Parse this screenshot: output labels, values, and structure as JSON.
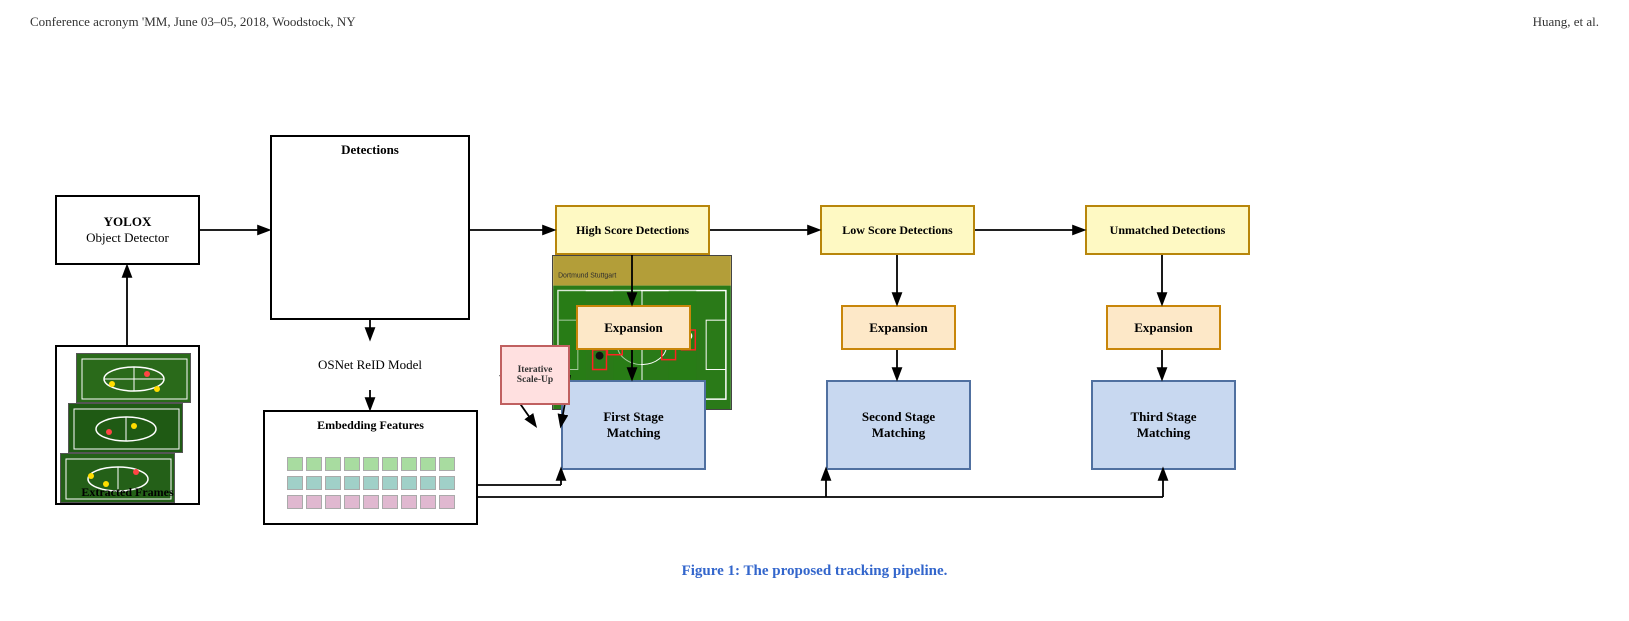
{
  "header": {
    "left": "Conference acronym 'MM, June 03–05, 2018, Woodstock, NY",
    "right": "Huang, et al."
  },
  "caption": "Figure 1: The proposed tracking pipeline.",
  "boxes": {
    "yolox_line1": "YOLOX",
    "yolox_line2": "Object Detector",
    "frames": "Extracted Frames",
    "detections_label": "Detections",
    "osnet": "OSNet ReID Model",
    "embedding": "Embedding Features",
    "high_score": "High Score Detections",
    "low_score": "Low Score Detections",
    "unmatched": "Unmatched Detections",
    "expansion": "Expansion",
    "first_match": "First Stage\nMatching",
    "second_match": "Second Stage\nMatching",
    "third_match": "Third Stage\nMatching",
    "iterative": "Iterative\nScale-Up"
  },
  "colors": {
    "yellow_border": "#b8860b",
    "yellow_bg": "#fef9c3",
    "orange_border": "#c8860a",
    "orange_bg": "#fde8c8",
    "blue_border": "#5070a0",
    "blue_bg": "#c8d8f0",
    "red_border": "#c06060",
    "red_bg": "#ffe0e0",
    "accent": "#3366cc"
  }
}
